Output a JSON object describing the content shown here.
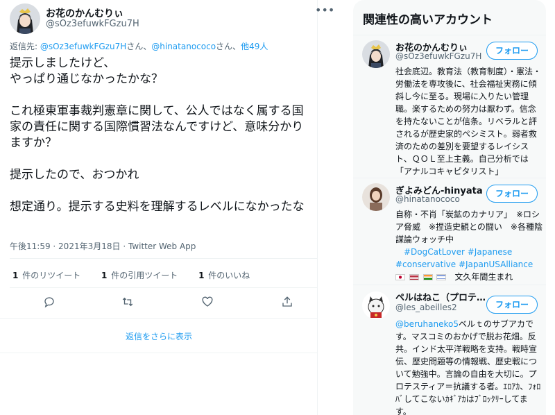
{
  "tweet": {
    "author_name": "お花のかんむりぃ",
    "author_handle": "@sOz3efuwkFGzu7H",
    "reply_prefix": "返信先: ",
    "reply_users": [
      "@sOz3efuwkFGzu7H",
      "@hinatanococo"
    ],
    "reply_user_suffix": "さん、",
    "reply_others": "他49人",
    "text": "提示しましたけど、\nやっぱり通じなかったかな？\n\nこれ極東軍事裁判憲章に関して、公人ではなく属する国家の責任に関する国際慣習法なんですけど、意味分かりますか？\n\n提示したので、おつかれ\n\n想定通り。提示する史料を理解するレベルになかったな",
    "time": "午後11:59",
    "date": "2021年3月18日",
    "separator": " · ",
    "source": "Twitter Web App",
    "stats": [
      {
        "count": "1",
        "label": "件のリツイート"
      },
      {
        "count": "1",
        "label": "件の引用ツイート"
      },
      {
        "count": "1",
        "label": "件のいいね"
      }
    ],
    "actions": [
      "reply-icon",
      "retweet-icon",
      "like-icon",
      "share-icon"
    ],
    "show_more_replies": "返信をさらに表示"
  },
  "sidebar": {
    "title": "関連性の高いアカウント",
    "follow_label": "フォロー",
    "accounts": [
      {
        "name": "お花のかんむりぃ",
        "handle": "@sOz3efuwkFGzu7H",
        "bio": "社会底辺。教育法（教育制度）・憲法・労働法を専攻後に、社会福祉実務に傾斜し今に至る。現場に入りたい管理職。楽するための努力は厭わず。信念を持たないことが信条。リベラルと評されるが歴史家的ペシミスト。弱者救済のための差別を要望するレイシスト、ＱＯＬ至上主義。自己分析では「アナルコキャピタリスト」"
      },
      {
        "name": "ぎよみどん-hinyata",
        "handle": "@hinatanococo",
        "bio_lines": [
          "自称・不肖「炭鉱のカナリア」　※ロシア脅威　※捏造史観との闘い　※各種陰謀論ウォッチ中"
        ],
        "tags_line1": "#DogCatLover #Japanese",
        "tags_line2": "#conservative #JapanUSAlliance",
        "flags_suffix": "文久年間生まれ",
        "flag_colors": [
          "#ffffff",
          "#b22234",
          "#ff9933",
          "#0038b8"
        ]
      },
      {
        "name": "ペルはねこ（プロテ…",
        "handle": "@les_abeilles2",
        "bio_mention": "@beruhaneko5",
        "bio": "ベルｔのサブアカです。マスコミのおかげで脱お花畑。反共。インド太平洋戦略を支持。戦時宣伝、歴史問題等の情報戦、歴史戦について勉強中。言論の自由を大切に。プロテスティア＝抗議する者。ｴﾛｱｶ、ﾌｫﾛﾊﾞしてこないｶｷﾞｱｶはﾌﾞﾛｯｸﾘｰしてます。"
      }
    ]
  },
  "colors": {
    "accent": "#1d9bf0",
    "secondary_text": "#536471",
    "border": "#eff3f4",
    "sidebar_bg": "#f7f9f9"
  }
}
